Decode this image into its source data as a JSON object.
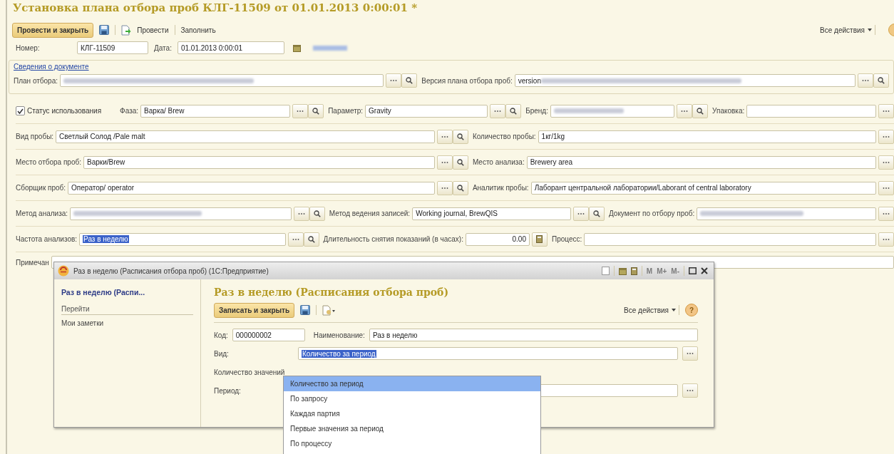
{
  "window": {
    "title": "Установка плана отбора проб КЛГ-11509 от 01.01.2013 0:00:01 *"
  },
  "toolbar": {
    "primary_button": "Провести и закрыть",
    "post_button": "Провести",
    "fill_button": "Заполнить",
    "all_actions": "Все действия"
  },
  "header": {
    "number_label": "Номер:",
    "number": "КЛГ-11509",
    "date_label": "Дата:",
    "date": "01.01.2013 0:00:01",
    "org_link_redacted": true
  },
  "group": {
    "link": "Сведения о документе",
    "fields": [
      {
        "label": "План отбора:",
        "kind": "reference",
        "redacted": true
      },
      {
        "label": "Версия плана отбора проб:",
        "value": "version",
        "kind": "reference",
        "redacted": true
      }
    ]
  },
  "status_checkbox": {
    "label": "Статус использования",
    "checked": true
  },
  "rows": [
    [
      {
        "label": "Фаза:",
        "value": "Варка/ Brew",
        "kind": "reference"
      },
      {
        "label": "Параметр:",
        "value": "Gravity",
        "kind": "reference"
      },
      {
        "label": "Бренд:",
        "kind": "reference",
        "redacted": true
      },
      {
        "label": "Упаковка:",
        "kind": "list"
      }
    ],
    [
      {
        "label": "Вид пробы:",
        "value": "Светлый Солод /Pale malt",
        "kind": "reference"
      },
      {
        "label": "Количество пробы:",
        "value": "1кг/1kg",
        "kind": "list"
      }
    ],
    [
      {
        "label": "Место отбора проб:",
        "value": "Варки/Brew",
        "kind": "reference"
      },
      {
        "label": "Место анализа:",
        "value": "Brewery area",
        "kind": "list"
      }
    ],
    [
      {
        "label": "Сборщик проб:",
        "value": "Оператор/ operator",
        "kind": "reference"
      },
      {
        "label": "Аналитик пробы:",
        "value": "Лаборант  центральной  лаборатории/Laborant of central laboratory",
        "kind": "list"
      }
    ],
    [
      {
        "label": "Метод анализа:",
        "kind": "reference",
        "redacted": true
      },
      {
        "label": "Метод ведения записей:",
        "value": "Working journal, BrewQIS",
        "kind": "reference"
      },
      {
        "label": "Документ по отбору проб:",
        "kind": "list",
        "redacted": true
      }
    ],
    [
      {
        "label": "Частота анализов:",
        "value": "Раз в неделю",
        "kind": "reference",
        "highlighted": true
      },
      {
        "label": "Длительность снятия показаний (в часах):",
        "value": "0.00",
        "kind": "number"
      },
      {
        "label": "Процесс:",
        "kind": "list"
      }
    ],
    [
      {
        "label": "Примечан",
        "kind": "plain"
      }
    ]
  ],
  "dialog": {
    "title": "Раз в неделю (Расписания отбора проб)  (1С:Предприятие)",
    "memory_buttons": [
      "M",
      "M+",
      "M-"
    ],
    "nav_title": "Раз в неделю (Распи...",
    "nav_section": "Перейти",
    "nav_items": [
      "Мои заметки"
    ],
    "heading": "Раз в неделю (Расписания отбора проб)",
    "primary_button": "Записать и закрыть",
    "all_actions": "Все действия",
    "help": "?",
    "code_label": "Код:",
    "code": "000000002",
    "name_label": "Наименование:",
    "name": "Раз в неделю",
    "kind_label": "Вид:",
    "kind": "Количество за период",
    "kind_highlighted": true,
    "count_label": "Количество значений",
    "period_label": "Период:"
  },
  "dropdown": [
    {
      "label": "Количество за период",
      "selected": true
    },
    {
      "label": "По запросу",
      "selected": false
    },
    {
      "label": "Каждая партия",
      "selected": false
    },
    {
      "label": "Первые значения за период",
      "selected": false
    },
    {
      "label": "По процессу",
      "selected": false
    }
  ]
}
